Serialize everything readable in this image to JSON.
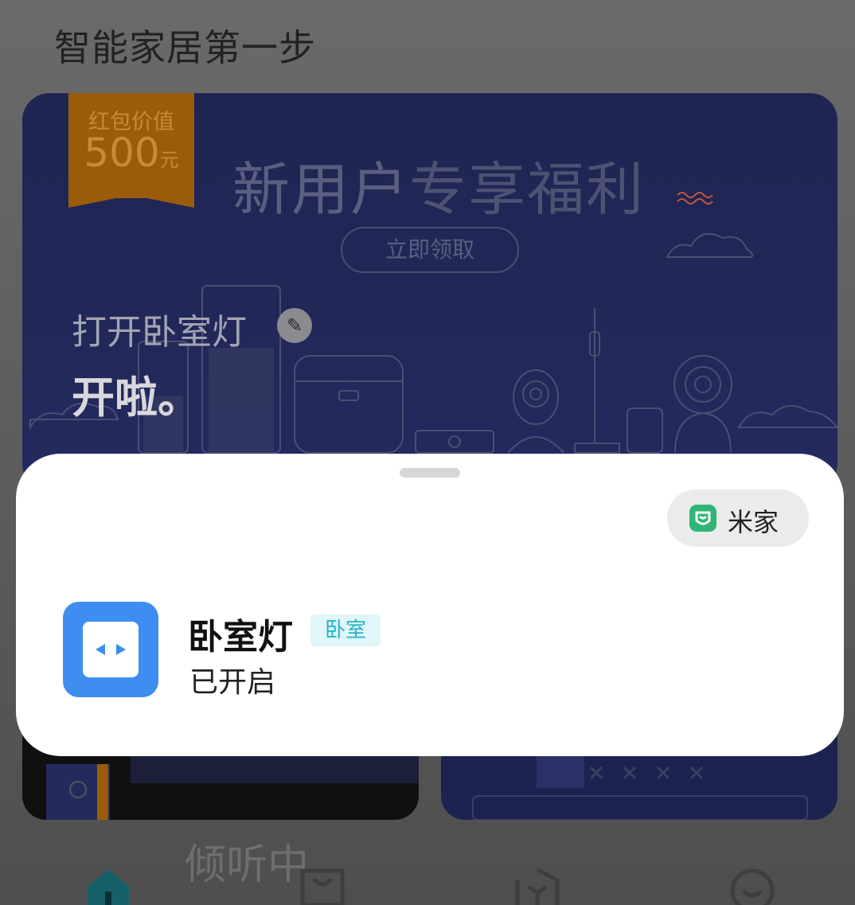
{
  "page": {
    "title": "智能家居第一步"
  },
  "banner": {
    "ribbon_label": "红包价值",
    "ribbon_amount": "500",
    "ribbon_unit": "元",
    "promo_main": "新用户",
    "promo_rest": "专享福利",
    "claim_label": "立即领取"
  },
  "greeting": {
    "line1": "打开卧室灯",
    "line2": "开啦。"
  },
  "listening_text": "倾听中",
  "bottom_nav": {
    "icons": [
      "home-icon",
      "store-icon",
      "scene-icon",
      "profile-icon"
    ]
  },
  "sheet": {
    "app_name": "米家",
    "device_name": "卧室灯",
    "room_tag": "卧室",
    "status": "已开启"
  },
  "colors": {
    "accent_blue": "#3d8ef0",
    "mijia_green": "#2fb575",
    "room_tag_text": "#20b7c9",
    "ribbon": "#9a5c0a"
  }
}
